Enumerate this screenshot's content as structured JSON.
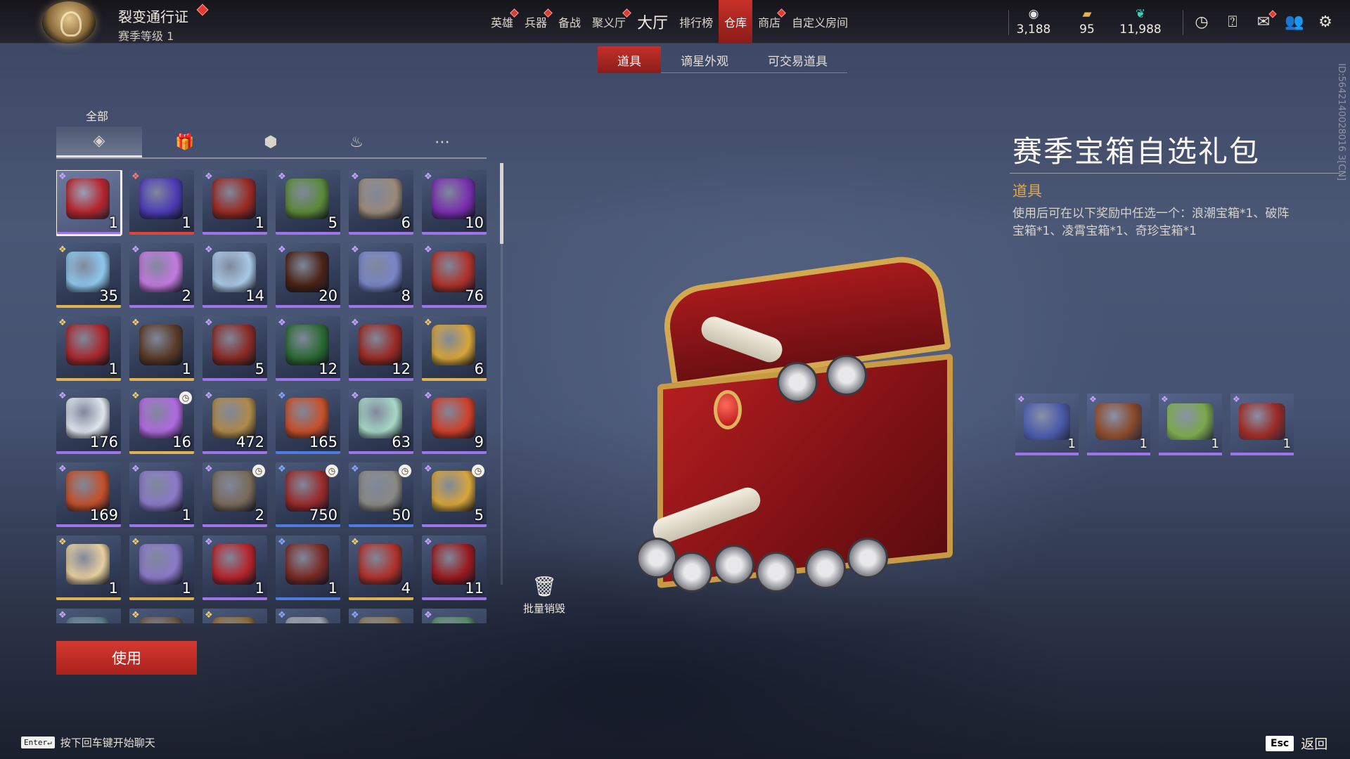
{
  "pass": {
    "title": "裂变通行证",
    "level": "赛季等级 1"
  },
  "nav": [
    {
      "label": "英雄",
      "dot": true
    },
    {
      "label": "兵器",
      "dot": true
    },
    {
      "label": "备战",
      "dot": false
    },
    {
      "label": "聚义厅",
      "dot": true
    },
    {
      "label": "大厅",
      "dot": false,
      "big": true
    },
    {
      "label": "排行榜",
      "dot": false
    },
    {
      "label": "仓库",
      "dot": false,
      "active": true
    },
    {
      "label": "商店",
      "dot": true
    },
    {
      "label": "自定义房间",
      "dot": false
    }
  ],
  "currencies": [
    {
      "icon": "coin-icon",
      "value": "3,188"
    },
    {
      "icon": "ticket-icon",
      "value": "95"
    },
    {
      "icon": "feather-icon",
      "value": "11,988"
    }
  ],
  "subtabs": [
    {
      "label": "道具",
      "active": true
    },
    {
      "label": "谪星外观",
      "active": false
    },
    {
      "label": "可交易道具",
      "active": false
    }
  ],
  "category_label": "全部",
  "categories": [
    {
      "icon": "layers-icon",
      "active": true
    },
    {
      "icon": "gift-icon",
      "active": false
    },
    {
      "icon": "lantern-icon",
      "active": false
    },
    {
      "icon": "flame-icon",
      "active": false
    },
    {
      "icon": "more-icon",
      "active": false
    }
  ],
  "items": [
    {
      "qty": "1",
      "rarity": "purple",
      "color": "#b6242a",
      "selected": true
    },
    {
      "qty": "1",
      "rarity": "red",
      "color": "#4d3cb8"
    },
    {
      "qty": "1",
      "rarity": "purple",
      "color": "#9a2a22"
    },
    {
      "qty": "5",
      "rarity": "purple",
      "color": "#5c8a3a"
    },
    {
      "qty": "6",
      "rarity": "purple",
      "color": "#9c8a7a"
    },
    {
      "qty": "10",
      "rarity": "purple",
      "color": "#7a2eb0"
    },
    {
      "qty": "35",
      "rarity": "gold",
      "color": "#8ec8ee"
    },
    {
      "qty": "2",
      "rarity": "purple",
      "color": "#c47ae0"
    },
    {
      "qty": "14",
      "rarity": "purple",
      "color": "#a9c9e6"
    },
    {
      "qty": "20",
      "rarity": "purple",
      "color": "#4a2216"
    },
    {
      "qty": "8",
      "rarity": "purple",
      "color": "#7a86c8"
    },
    {
      "qty": "76",
      "rarity": "purple",
      "color": "#b0322a"
    },
    {
      "qty": "1",
      "rarity": "gold",
      "color": "#a8282c"
    },
    {
      "qty": "1",
      "rarity": "gold",
      "color": "#5a3a26"
    },
    {
      "qty": "5",
      "rarity": "purple",
      "color": "#8a2a24"
    },
    {
      "qty": "12",
      "rarity": "purple",
      "color": "#2a6a32"
    },
    {
      "qty": "12",
      "rarity": "purple",
      "color": "#9a2a22"
    },
    {
      "qty": "6",
      "rarity": "gold",
      "color": "#d8a63a"
    },
    {
      "qty": "176",
      "rarity": "purple",
      "color": "#dfe6ee"
    },
    {
      "qty": "16",
      "rarity": "gold",
      "color": "#b06ae0",
      "timer": true
    },
    {
      "qty": "472",
      "rarity": "purple",
      "color": "#b08a4a"
    },
    {
      "qty": "165",
      "rarity": "blue",
      "color": "#c8502a"
    },
    {
      "qty": "63",
      "rarity": "purple",
      "color": "#a8d8c8"
    },
    {
      "qty": "9",
      "rarity": "purple",
      "color": "#d0402a"
    },
    {
      "qty": "169",
      "rarity": "purple",
      "color": "#c4502a"
    },
    {
      "qty": "1",
      "rarity": "purple",
      "color": "#8a7ac8"
    },
    {
      "qty": "2",
      "rarity": "purple",
      "color": "#7a6a5a",
      "timer": true
    },
    {
      "qty": "750",
      "rarity": "blue",
      "color": "#9a2a2a",
      "timer": true
    },
    {
      "qty": "50",
      "rarity": "blue",
      "color": "#8a8a86",
      "timer": true
    },
    {
      "qty": "5",
      "rarity": "purple",
      "color": "#d8a63a",
      "timer": true
    },
    {
      "qty": "1",
      "rarity": "gold",
      "color": "#e8d0a0"
    },
    {
      "qty": "1",
      "rarity": "gold",
      "color": "#8a7ac8"
    },
    {
      "qty": "1",
      "rarity": "purple",
      "color": "#b6242a"
    },
    {
      "qty": "1",
      "rarity": "blue",
      "color": "#7a2a24"
    },
    {
      "qty": "4",
      "rarity": "gold",
      "color": "#b0322a"
    },
    {
      "qty": "11",
      "rarity": "purple",
      "color": "#9a1a1e"
    },
    {
      "qty": "",
      "rarity": "purple",
      "color": "#5a7a8a"
    },
    {
      "qty": "",
      "rarity": "gold",
      "color": "#6a5a4a"
    },
    {
      "qty": "",
      "rarity": "gold",
      "color": "#8a6a3a"
    },
    {
      "qty": "",
      "rarity": "blue",
      "color": "#9aa0aa"
    },
    {
      "qty": "",
      "rarity": "blue",
      "color": "#8a7a5a"
    },
    {
      "qty": "",
      "rarity": "purple",
      "color": "#5a8a6a"
    }
  ],
  "use_button": "使用",
  "batch_destroy": "批量销毁",
  "detail": {
    "title": "赛季宝箱自选礼包",
    "category": "道具",
    "description": "使用后可在以下奖励中任选一个：浪潮宝箱*1、破阵宝箱*1、凌霄宝箱*1、奇珍宝箱*1",
    "id_text": "ID:5642140028016 3[CN]",
    "rewards": [
      {
        "qty": "1",
        "color": "#4a5aa8"
      },
      {
        "qty": "1",
        "color": "#8a4a2a"
      },
      {
        "qty": "1",
        "color": "#7aa84a"
      },
      {
        "qty": "1",
        "color": "#9a2a24"
      }
    ]
  },
  "chat_hint": {
    "key": "Enter↵",
    "text": "按下回车键开始聊天"
  },
  "back": {
    "key": "Esc",
    "label": "返回"
  }
}
